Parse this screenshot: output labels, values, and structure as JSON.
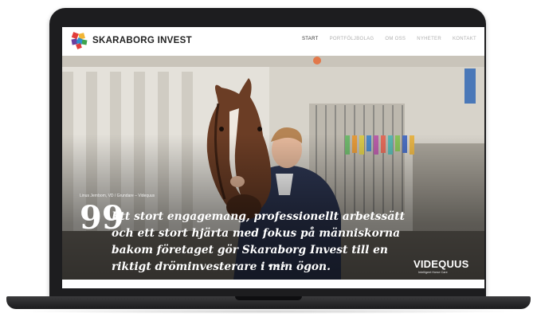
{
  "brand": {
    "name": "SKARABORG INVEST",
    "logo_icon": "puzzle-logo-icon"
  },
  "nav": {
    "items": [
      {
        "label": "START",
        "active": true
      },
      {
        "label": "PORTFÖLJBOLAG",
        "active": false
      },
      {
        "label": "OM OSS",
        "active": false
      },
      {
        "label": "NYHETER",
        "active": false
      },
      {
        "label": "KONTAKT",
        "active": false
      }
    ]
  },
  "hero": {
    "caption": "Linus Jernbom, VD / Grundare – Videquus",
    "quote_mark": "99",
    "quote_lines": [
      "Ett stort engagemang, professionellt arbetssätt",
      "och ett stort hjärta med fokus på människorna",
      "bakom företaget gör Skaraborg Invest till en",
      "riktigt dröminvesterare i min ögon."
    ],
    "partner": {
      "name": "VIDEQUUS",
      "tagline": "Intelligent Horse Care"
    },
    "slides": {
      "count": 4,
      "active_index": 1
    }
  },
  "colors": {
    "laptop_frame": "#1d1d1f",
    "nav_active": "#333333",
    "nav_inactive": "#b0b0b0",
    "logo": [
      "#e23d3a",
      "#f2b534",
      "#2c8fcf",
      "#6a3f9e",
      "#3fa34d"
    ]
  }
}
